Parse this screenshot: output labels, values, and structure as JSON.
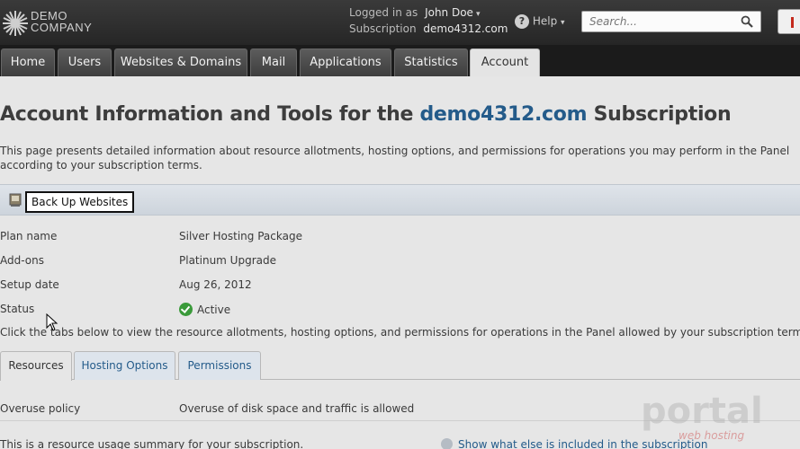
{
  "header": {
    "logo_line1": "DEMO",
    "logo_line2": "COMPANY",
    "logged_in_label": "Logged in as",
    "user_name": "John Doe",
    "subscription_label": "Subscription",
    "subscription_value": "demo4312.com",
    "help_label": "Help",
    "search_placeholder": "Search..."
  },
  "nav": {
    "tabs": [
      {
        "label": "Home"
      },
      {
        "label": "Users"
      },
      {
        "label": "Websites & Domains"
      },
      {
        "label": "Mail"
      },
      {
        "label": "Applications"
      },
      {
        "label": "Statistics"
      },
      {
        "label": "Account",
        "active": true
      }
    ]
  },
  "page": {
    "title_prefix": "Account Information and Tools for the",
    "title_domain": "demo4312.com",
    "title_suffix": "Subscription",
    "intro": "This page presents detailed information about resource allotments, hosting options, and permissions for operations you may perform in the Panel according to your subscription terms.",
    "toolbar": {
      "backup_label": "Back Up Websites"
    },
    "info": [
      {
        "key": "Plan name",
        "value": "Silver Hosting Package"
      },
      {
        "key": "Add-ons",
        "value": "Platinum Upgrade"
      },
      {
        "key": "Setup date",
        "value": "Aug 26, 2012"
      },
      {
        "key": "Status",
        "value": "Active"
      }
    ],
    "note": "Click the tabs below to view the resource allotments, hosting options, and permissions for operations in the Panel allowed by your subscription terms.",
    "subtabs": [
      {
        "label": "Resources",
        "active": true
      },
      {
        "label": "Hosting Options"
      },
      {
        "label": "Permissions"
      }
    ],
    "overuse_key": "Overuse policy",
    "overuse_value": "Overuse of disk space and traffic is allowed",
    "summary": "This is a resource usage summary for your subscription.",
    "more_link": "Show what else is included in the subscription"
  },
  "watermark": {
    "line1": "portal",
    "line2": "web hosting"
  },
  "colors": {
    "accent": "#245b8a",
    "status_ok": "#3a9a3a",
    "nav_bg": "#1b1b1b"
  }
}
